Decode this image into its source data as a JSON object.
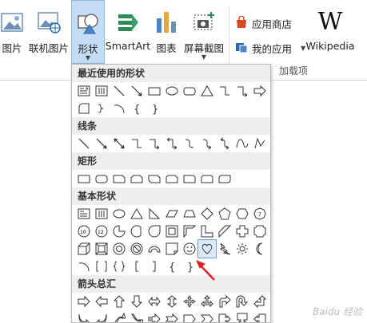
{
  "ribbon": {
    "buttons": [
      {
        "label": "图片"
      },
      {
        "label": "联机图片"
      },
      {
        "label": "形状"
      },
      {
        "label": "SmartArt"
      },
      {
        "label": "图表"
      },
      {
        "label": "屏幕截图"
      }
    ],
    "addins": {
      "store_label": "应用商店",
      "myapps_label": "我的应用",
      "wiki_label": "Wikipedia",
      "group_label": "加载项"
    }
  },
  "dropdown": {
    "categories": [
      {
        "title": "最近使用的形状"
      },
      {
        "title": "线条"
      },
      {
        "title": "矩形"
      },
      {
        "title": "基本形状"
      },
      {
        "title": "箭头总汇"
      }
    ],
    "brace_glyphs": {
      "open": "{",
      "close": "}"
    }
  },
  "colors": {
    "accent": "#c5ddf4",
    "annotation_arrow": "#e02020",
    "store_icon": "#d24726",
    "myapps_icon": "#2a66b3"
  },
  "watermark": "Baidu 经验"
}
